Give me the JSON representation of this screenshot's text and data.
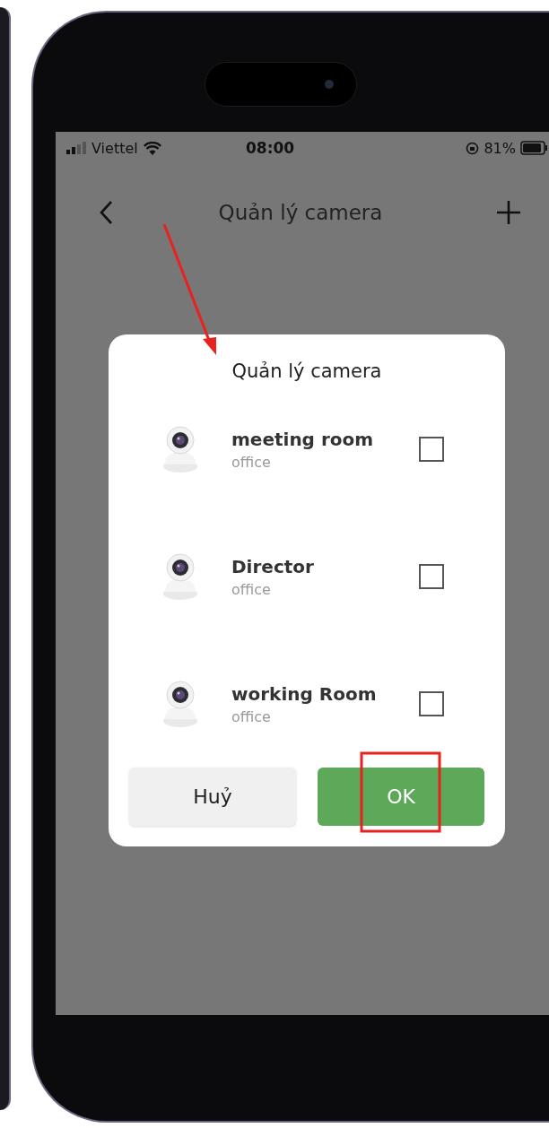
{
  "status_bar": {
    "carrier": "Viettel",
    "time": "08:00",
    "battery": "81%"
  },
  "header": {
    "title": "Quản lý camera"
  },
  "dialog": {
    "title": "Quản lý camera",
    "cameras": [
      {
        "name": "meeting room",
        "location": "office",
        "checked": false
      },
      {
        "name": "Director",
        "location": "office",
        "checked": false
      },
      {
        "name": "working Room",
        "location": "office",
        "checked": false
      }
    ],
    "buttons": [
      {
        "label": "Huỷ",
        "kind": "secondary"
      },
      {
        "label": "OK",
        "kind": "primary"
      }
    ]
  }
}
